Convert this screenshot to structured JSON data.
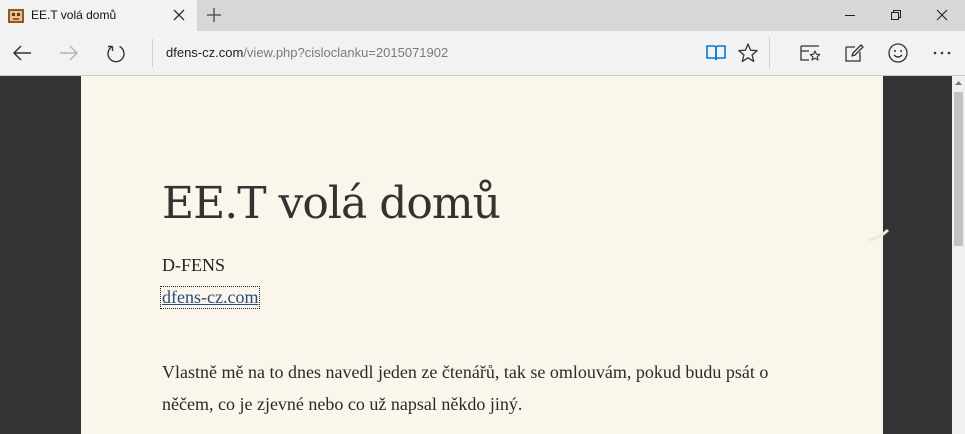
{
  "tab": {
    "title": "EE.T volá domů"
  },
  "address": {
    "host": "dfens-cz.com",
    "path": "/view.php?cisloclanku=2015071902"
  },
  "article": {
    "title": "EE.T volá domů",
    "author": "D-FENS",
    "source_link": "dfens-cz.com",
    "paragraph": "Vlastně mě na to dnes navedl jeden ze čtenářů, tak se omlouvám, pokud budu psát o něčem, co je zjevné nebo co už napsal někdo jiný."
  },
  "colors": {
    "accent": "#0078d7",
    "reading_bg": "#faf6ec",
    "side_bg": "#333333"
  }
}
